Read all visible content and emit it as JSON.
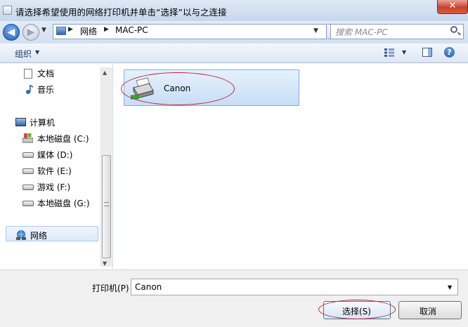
{
  "window": {
    "title": "请选择希望使用的网络打印机并单击“选择”以与之连接",
    "close_label": "✕"
  },
  "nav": {
    "back_glyph": "◀",
    "forward_glyph": "▶",
    "breadcrumb": [
      "网络",
      "MAC-PC"
    ],
    "search_placeholder": "搜索 MAC-PC"
  },
  "toolbar": {
    "organize_label": "组织"
  },
  "sidebar": {
    "items": [
      {
        "label": "文档",
        "icon": "document-icon"
      },
      {
        "label": "音乐",
        "icon": "music-icon"
      },
      {
        "label": "计算机",
        "icon": "computer-icon"
      },
      {
        "label": "本地磁盘 (C:)",
        "icon": "drive-c-icon"
      },
      {
        "label": "媒体 (D:)",
        "icon": "drive-icon"
      },
      {
        "label": "软件 (E:)",
        "icon": "drive-icon"
      },
      {
        "label": "游戏 (F:)",
        "icon": "drive-icon"
      },
      {
        "label": "本地磁盘 (G:)",
        "icon": "drive-icon"
      },
      {
        "label": "网络",
        "icon": "network-icon"
      }
    ]
  },
  "content": {
    "items": [
      {
        "label": "Canon",
        "icon": "printer-icon",
        "selected": true
      }
    ]
  },
  "footer": {
    "printer_label": "打印机(P)",
    "printer_value": "Canon",
    "select_label": "选择(S)",
    "cancel_label": "取消"
  },
  "colors": {
    "annotation_ellipse": "#c0203a",
    "selection_fill": "#cfe3f8",
    "selection_border": "#84acdd"
  }
}
